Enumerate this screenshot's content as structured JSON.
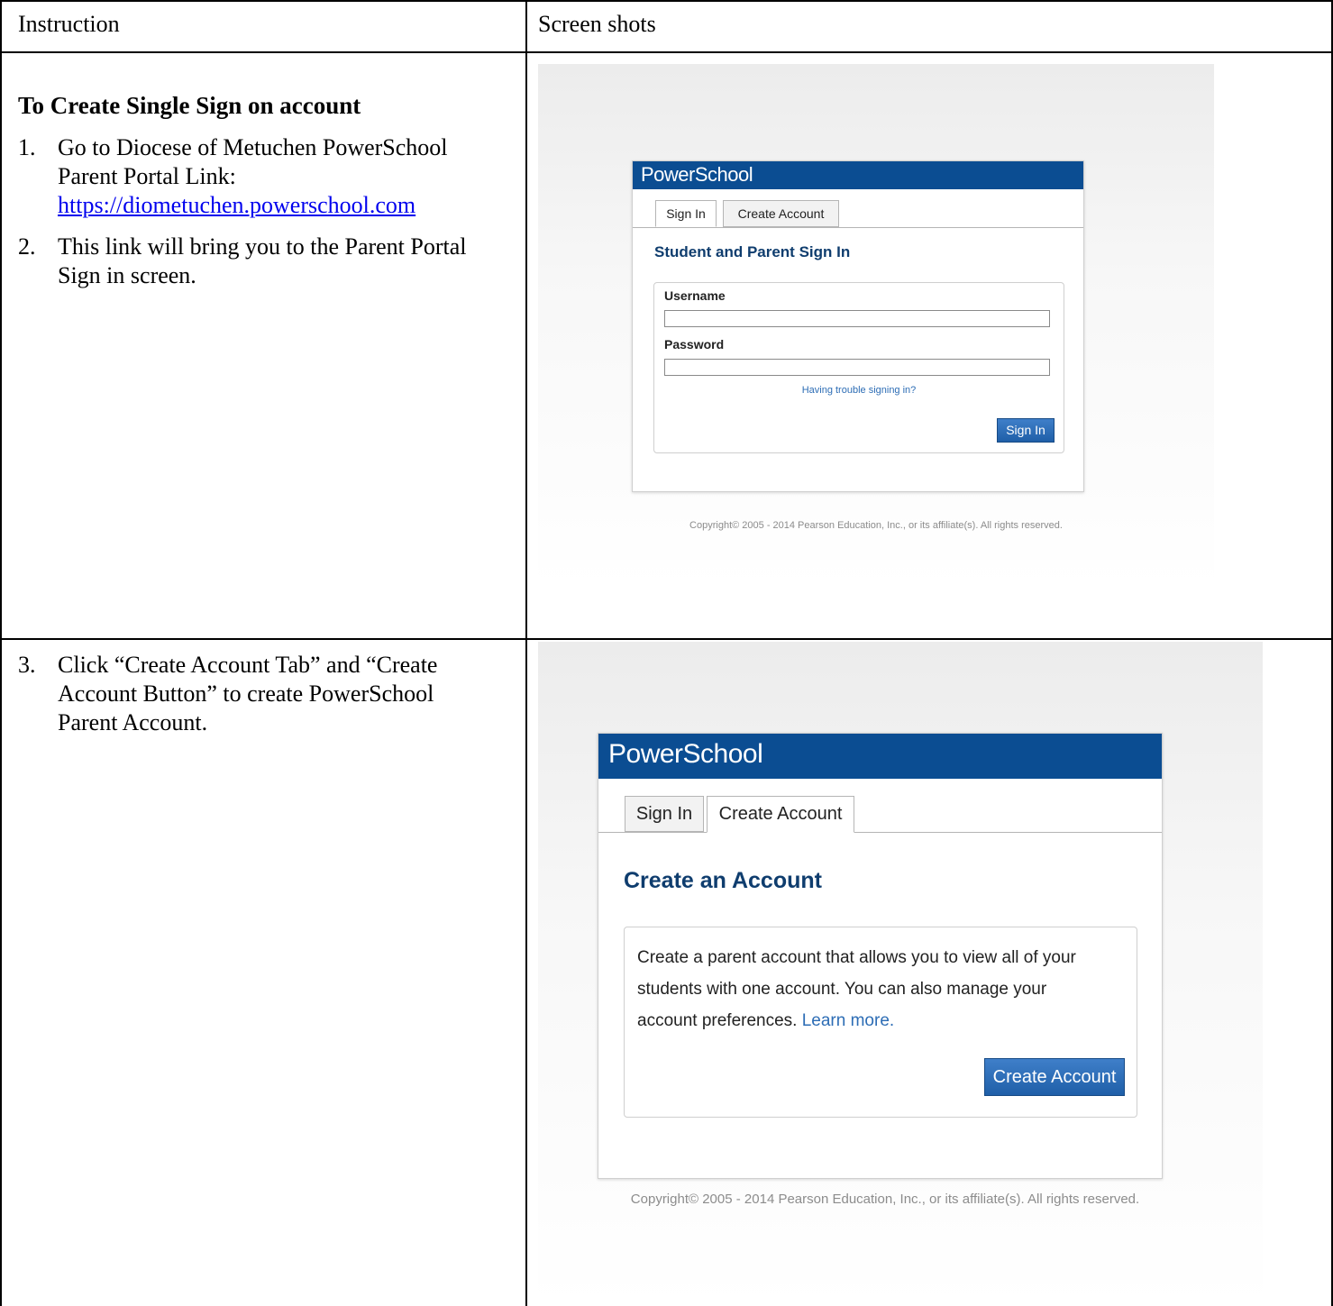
{
  "table": {
    "header_left": "Instruction",
    "header_right": "Screen shots"
  },
  "row1": {
    "title": "To Create Single Sign on account",
    "step1_num": "1.",
    "step1_text": "Go to Diocese of Metuchen PowerSchool Parent Portal Link:",
    "step1_link": "https://diometuchen.powerschool.com",
    "step2_num": "2.",
    "step2_text": "This link will bring you to the Parent Portal Sign in screen."
  },
  "row2": {
    "step3_num": "3.",
    "step3_text": "Click “Create Account Tab” and “Create Account Button” to create PowerSchool Parent Account."
  },
  "shot1": {
    "logo": "PowerSchool",
    "tab_signin": "Sign In",
    "tab_create": "Create Account",
    "heading": "Student and Parent Sign In",
    "username_label": "Username",
    "password_label": "Password",
    "trouble_link": "Having trouble signing in?",
    "signin_button": "Sign In",
    "copyright": "Copyright© 2005 - 2014 Pearson Education, Inc., or its affiliate(s). All rights reserved."
  },
  "shot2": {
    "logo": "PowerSchool",
    "tab_signin": "Sign In",
    "tab_create": "Create Account",
    "heading": "Create an Account",
    "description": "Create a parent account that allows you to view all of your students with one account. You can also manage your account preferences.",
    "learn_more": "Learn more.",
    "create_button": "Create Account",
    "copyright": "Copyright© 2005 - 2014 Pearson Education, Inc., or its affiliate(s). All rights reserved."
  }
}
